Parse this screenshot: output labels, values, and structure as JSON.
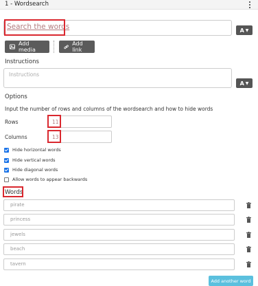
{
  "header": {
    "title": "1 - Wordsearch",
    "menu_icon": "kebab-menu-icon"
  },
  "title_field": {
    "placeholder": "Search the words"
  },
  "font_button_label": "A",
  "toolbar": {
    "add_media_label": "Add media",
    "add_link_label": "Add link"
  },
  "instructions": {
    "label": "Instructions",
    "placeholder": "Instructions"
  },
  "options": {
    "label": "Options",
    "description": "Input the number of rows and columns of the wordsearch and how to hide words",
    "rows_label": "Rows",
    "rows_value": "11",
    "columns_label": "Columns",
    "columns_value": "13",
    "checkboxes": [
      {
        "label": "Hide horizontal words",
        "checked": true
      },
      {
        "label": "Hide vertical words",
        "checked": true
      },
      {
        "label": "Hide diagonal words",
        "checked": true
      },
      {
        "label": "Allow words to appear backwards",
        "checked": false
      }
    ]
  },
  "words": {
    "label": "Words",
    "items": [
      "pirate",
      "princess",
      "jewels",
      "beach",
      "tavern"
    ],
    "add_label": "Add another word"
  },
  "colors": {
    "highlight": "#d9272e",
    "accent": "#5bc0de",
    "dark_button": "#5b5b5b",
    "checkbox": "#1a73e8"
  }
}
